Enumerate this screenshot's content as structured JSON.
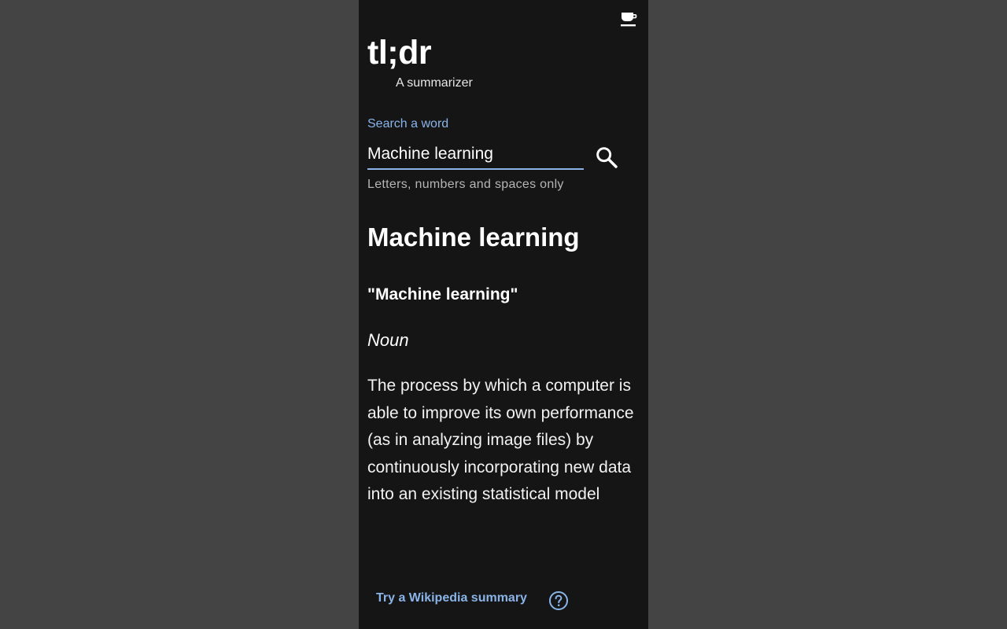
{
  "app": {
    "title": "tl;dr",
    "subtitle": "A summarizer"
  },
  "search": {
    "label": "Search a word",
    "value": "Machine learning",
    "helper": "Letters, numbers and spaces only"
  },
  "result": {
    "title": "Machine learning",
    "term": "\"Machine learning\"",
    "part_of_speech": "Noun",
    "definition": "The process by which a computer is able to improve its own performance (as in analyzing image files) by continuously incorporating new data into an existing statistical model"
  },
  "footer": {
    "wikipedia_link": "Try a Wikipedia summary"
  },
  "icons": {
    "top_right": "coffee-cup-icon",
    "search": "search-icon",
    "help": "help-circle-icon"
  },
  "colors": {
    "accent": "#8ab4e8",
    "panel_bg": "#151515",
    "outer_bg": "#444444"
  }
}
